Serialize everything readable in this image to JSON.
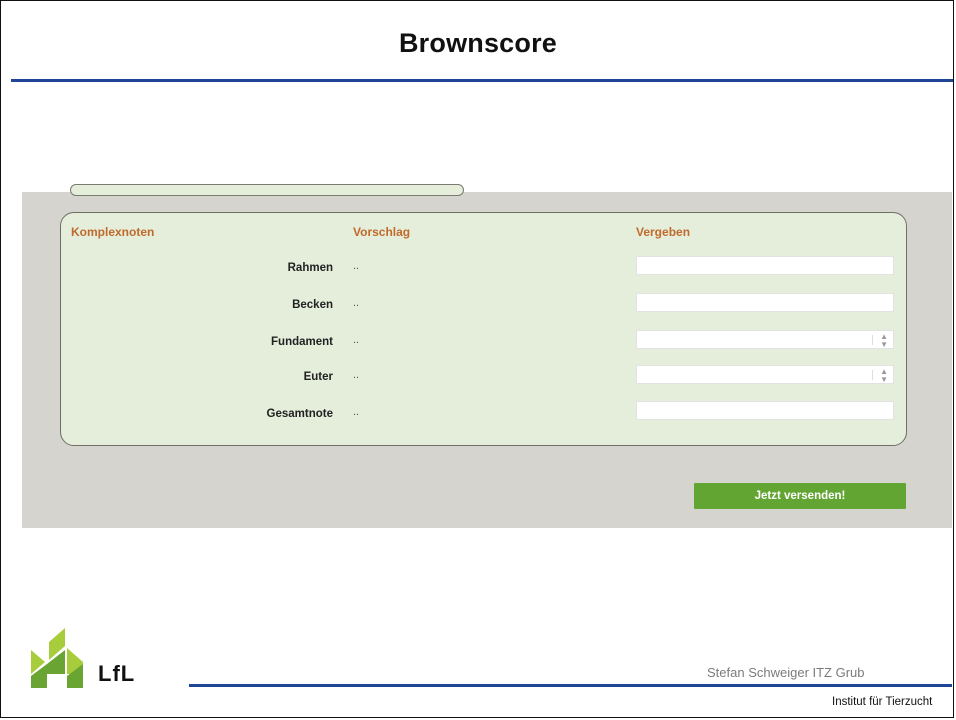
{
  "slide": {
    "title": "Brownscore",
    "author": "Stefan Schweiger ITZ Grub",
    "institute": "Institut für Tierzucht",
    "logo_text": "LfL"
  },
  "form": {
    "headers": {
      "col1": "Komplexnoten",
      "col2": "Vorschlag",
      "col3": "Vergeben"
    },
    "rows": [
      {
        "label": "Rahmen",
        "suggestion": "..",
        "field_type": "text"
      },
      {
        "label": "Becken",
        "suggestion": "..",
        "field_type": "text"
      },
      {
        "label": "Fundament",
        "suggestion": "..",
        "field_type": "select"
      },
      {
        "label": "Euter",
        "suggestion": "..",
        "field_type": "select"
      },
      {
        "label": "Gesamtnote",
        "suggestion": "..",
        "field_type": "text"
      }
    ],
    "submit_label": "Jetzt versenden!"
  },
  "colors": {
    "accent_blue": "#1f4597",
    "header_orange": "#c06a2b",
    "card_green": "#e4eedb",
    "button_green": "#63a533",
    "panel_gray": "#d5d4ce",
    "logo_green_light": "#a8cd3c",
    "logo_green_dark": "#6aa534"
  }
}
